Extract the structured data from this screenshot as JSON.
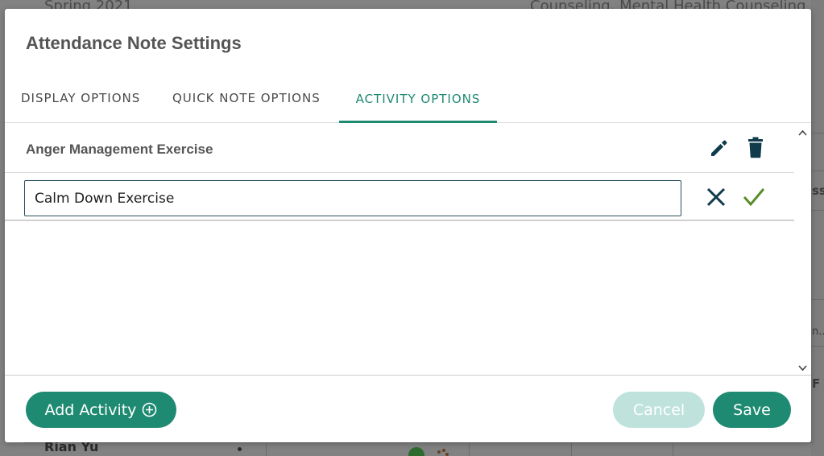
{
  "background": {
    "top_left_text": "Spring 2021",
    "top_right_text": "Counseling, Mental Health Counseling, Emp",
    "right_fragment_1": "ss",
    "right_fragment_2": "n..",
    "right_fragment_3": "F",
    "bottom_name": "Rian Yu"
  },
  "modal": {
    "title": "Attendance Note Settings",
    "tabs": [
      {
        "label": "DISPLAY OPTIONS",
        "active": false
      },
      {
        "label": "QUICK NOTE OPTIONS",
        "active": false
      },
      {
        "label": "ACTIVITY OPTIONS",
        "active": true
      }
    ],
    "activities": [
      {
        "name": "Anger Management Exercise"
      }
    ],
    "edit_input": {
      "value": "Calm Down Exercise",
      "placeholder": ""
    },
    "footer": {
      "add_activity_label": "Add Activity",
      "cancel_label": "Cancel",
      "save_label": "Save"
    }
  },
  "colors": {
    "accent": "#1f8a72",
    "accent_disabled": "#bfe3dc",
    "confirm_check": "#5b8c2a",
    "icon_dark": "#0f3b4c",
    "title_text": "#555555"
  },
  "icons": [
    "pencil-icon",
    "trash-icon",
    "close-icon",
    "checkmark-icon",
    "plus-circle-icon",
    "chevron-up-icon",
    "chevron-down-icon"
  ]
}
